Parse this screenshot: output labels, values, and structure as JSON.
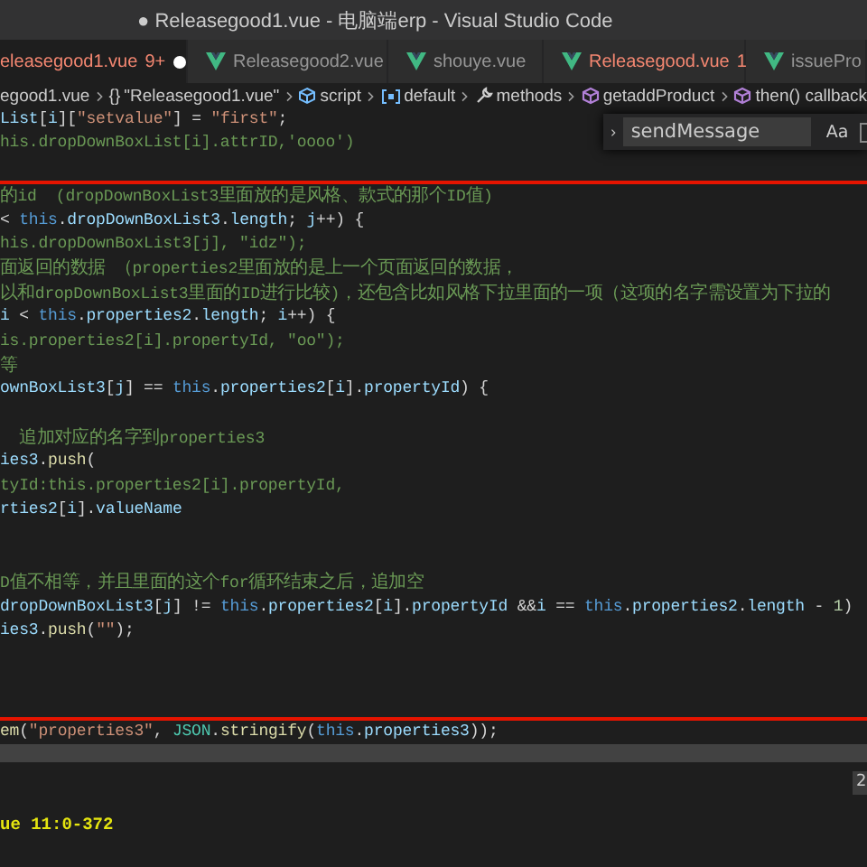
{
  "window": {
    "title": "● Releasegood1.vue - 电脑端erp - Visual Studio Code"
  },
  "tabs": [
    {
      "label": "eleasegood1.vue",
      "problems": "9+",
      "kind": "cut",
      "selected": true,
      "has_errors": true,
      "dirty": true
    },
    {
      "label": "Releasegood2.vue",
      "kind": "file",
      "selected": false,
      "has_errors": false,
      "dirty": false
    },
    {
      "label": "shouye.vue",
      "kind": "file",
      "selected": false,
      "has_errors": false,
      "dirty": false
    },
    {
      "label": "Releasegood.vue",
      "problems": "1",
      "kind": "file",
      "selected": false,
      "has_errors": true,
      "dirty": false
    },
    {
      "label": "issuePro",
      "kind": "file",
      "selected": false,
      "has_errors": false,
      "dirty": false
    }
  ],
  "breadcrumbs": [
    {
      "label": "egood1.vue",
      "kind": "file"
    },
    {
      "label": "\"Releasegood1.vue\"",
      "kind": "object",
      "glyph": "{}"
    },
    {
      "label": "script",
      "kind": "module"
    },
    {
      "label": "default",
      "kind": "variable"
    },
    {
      "label": "methods",
      "kind": "property"
    },
    {
      "label": "getaddProduct",
      "kind": "method"
    },
    {
      "label": "then() callback",
      "kind": "method"
    }
  ],
  "editor": {
    "lines": [
      {
        "kind": "code",
        "tokens": [
          {
            "kind": "variable",
            "t": "List"
          },
          {
            "kind": "plain",
            "t": "["
          },
          {
            "kind": "variable",
            "t": "i"
          },
          {
            "kind": "plain",
            "t": "]["
          },
          {
            "kind": "string",
            "t": "\"setvalue\""
          },
          {
            "kind": "plain",
            "t": "] = "
          },
          {
            "kind": "string",
            "t": "\"first\""
          },
          {
            "kind": "plain",
            "t": ";"
          }
        ]
      },
      {
        "kind": "code",
        "tokens": [
          {
            "kind": "comment",
            "t": "his.dropDownBoxList[i].attrID,'oooo')"
          }
        ]
      },
      {
        "kind": "blank"
      },
      {
        "kind": "marker"
      },
      {
        "kind": "code",
        "tokens": [
          {
            "kind": "comment",
            "t": "的id  (dropDownBoxList3里面放的是风格、款式的那个ID值)"
          }
        ]
      },
      {
        "kind": "code",
        "tokens": [
          {
            "kind": "plain",
            "t": "< "
          },
          {
            "kind": "keyword",
            "t": "this"
          },
          {
            "kind": "plain",
            "t": "."
          },
          {
            "kind": "variable",
            "t": "dropDownBoxList3"
          },
          {
            "kind": "plain",
            "t": "."
          },
          {
            "kind": "variable",
            "t": "length"
          },
          {
            "kind": "plain",
            "t": "; "
          },
          {
            "kind": "variable",
            "t": "j"
          },
          {
            "kind": "plain",
            "t": "++) {"
          }
        ]
      },
      {
        "kind": "code",
        "tokens": [
          {
            "kind": "comment",
            "t": "his.dropDownBoxList3[j], \"idz\");"
          }
        ]
      },
      {
        "kind": "code",
        "tokens": [
          {
            "kind": "comment",
            "t": "面返回的数据 （properties2里面放的是上一个页面返回的数据，"
          }
        ]
      },
      {
        "kind": "code",
        "tokens": [
          {
            "kind": "comment",
            "t": "以和dropDownBoxList3里面的ID进行比较)，还包含比如风格下拉里面的一项（这项的名字需设置为下拉的"
          }
        ]
      },
      {
        "kind": "code",
        "tokens": [
          {
            "kind": "variable",
            "t": "i"
          },
          {
            "kind": "plain",
            "t": " < "
          },
          {
            "kind": "keyword",
            "t": "this"
          },
          {
            "kind": "plain",
            "t": "."
          },
          {
            "kind": "variable",
            "t": "properties2"
          },
          {
            "kind": "plain",
            "t": "."
          },
          {
            "kind": "variable",
            "t": "length"
          },
          {
            "kind": "plain",
            "t": "; "
          },
          {
            "kind": "variable",
            "t": "i"
          },
          {
            "kind": "plain",
            "t": "++) {"
          }
        ]
      },
      {
        "kind": "code",
        "tokens": [
          {
            "kind": "comment",
            "t": "is.properties2[i].propertyId, \"oo\");"
          }
        ]
      },
      {
        "kind": "code",
        "tokens": [
          {
            "kind": "comment",
            "t": "等"
          }
        ]
      },
      {
        "kind": "code",
        "tokens": [
          {
            "kind": "variable",
            "t": "ownBoxList3"
          },
          {
            "kind": "plain",
            "t": "["
          },
          {
            "kind": "variable",
            "t": "j"
          },
          {
            "kind": "plain",
            "t": "] == "
          },
          {
            "kind": "keyword",
            "t": "this"
          },
          {
            "kind": "plain",
            "t": "."
          },
          {
            "kind": "variable",
            "t": "properties2"
          },
          {
            "kind": "plain",
            "t": "["
          },
          {
            "kind": "variable",
            "t": "i"
          },
          {
            "kind": "plain",
            "t": "]."
          },
          {
            "kind": "variable",
            "t": "propertyId"
          },
          {
            "kind": "plain",
            "t": ") {"
          }
        ]
      },
      {
        "kind": "blank"
      },
      {
        "kind": "code",
        "tokens": [
          {
            "kind": "comment",
            "t": "  追加对应的名字到properties3"
          }
        ]
      },
      {
        "kind": "code",
        "tokens": [
          {
            "kind": "variable",
            "t": "ies3"
          },
          {
            "kind": "plain",
            "t": "."
          },
          {
            "kind": "function",
            "t": "push"
          },
          {
            "kind": "plain",
            "t": "("
          }
        ]
      },
      {
        "kind": "code",
        "tokens": [
          {
            "kind": "comment",
            "t": "tyId:this.properties2[i].propertyId,"
          }
        ]
      },
      {
        "kind": "code",
        "tokens": [
          {
            "kind": "variable",
            "t": "rties2"
          },
          {
            "kind": "plain",
            "t": "["
          },
          {
            "kind": "variable",
            "t": "i"
          },
          {
            "kind": "plain",
            "t": "]."
          },
          {
            "kind": "variable",
            "t": "valueName"
          }
        ]
      },
      {
        "kind": "blank"
      },
      {
        "kind": "blank"
      },
      {
        "kind": "code",
        "tokens": [
          {
            "kind": "comment",
            "t": "D值不相等，并且里面的这个for循环结束之后，追加空"
          }
        ]
      },
      {
        "kind": "code",
        "tokens": [
          {
            "kind": "variable",
            "t": "dropDownBoxList3"
          },
          {
            "kind": "plain",
            "t": "["
          },
          {
            "kind": "variable",
            "t": "j"
          },
          {
            "kind": "plain",
            "t": "] != "
          },
          {
            "kind": "keyword",
            "t": "this"
          },
          {
            "kind": "plain",
            "t": "."
          },
          {
            "kind": "variable",
            "t": "properties2"
          },
          {
            "kind": "plain",
            "t": "["
          },
          {
            "kind": "variable",
            "t": "i"
          },
          {
            "kind": "plain",
            "t": "]."
          },
          {
            "kind": "variable",
            "t": "propertyId"
          },
          {
            "kind": "plain",
            "t": " &&"
          },
          {
            "kind": "variable",
            "t": "i"
          },
          {
            "kind": "plain",
            "t": " == "
          },
          {
            "kind": "keyword",
            "t": "this"
          },
          {
            "kind": "plain",
            "t": "."
          },
          {
            "kind": "variable",
            "t": "properties2"
          },
          {
            "kind": "plain",
            "t": "."
          },
          {
            "kind": "variable",
            "t": "length"
          },
          {
            "kind": "plain",
            "t": " - "
          },
          {
            "kind": "number",
            "t": "1"
          },
          {
            "kind": "plain",
            "t": ")"
          }
        ]
      },
      {
        "kind": "code",
        "tokens": [
          {
            "kind": "variable",
            "t": "ies3"
          },
          {
            "kind": "plain",
            "t": "."
          },
          {
            "kind": "function",
            "t": "push"
          },
          {
            "kind": "plain",
            "t": "("
          },
          {
            "kind": "string",
            "t": "\"\""
          },
          {
            "kind": "plain",
            "t": ");"
          }
        ]
      },
      {
        "kind": "blank"
      },
      {
        "kind": "blank"
      },
      {
        "kind": "blank"
      },
      {
        "kind": "marker"
      },
      {
        "kind": "code",
        "tokens": [
          {
            "kind": "function",
            "t": "em"
          },
          {
            "kind": "plain",
            "t": "("
          },
          {
            "kind": "string",
            "t": "\"properties3\""
          },
          {
            "kind": "plain",
            "t": ", "
          },
          {
            "kind": "type",
            "t": "JSON"
          },
          {
            "kind": "plain",
            "t": "."
          },
          {
            "kind": "function",
            "t": "stringify"
          },
          {
            "kind": "plain",
            "t": "("
          },
          {
            "kind": "keyword",
            "t": "this"
          },
          {
            "kind": "plain",
            "t": "."
          },
          {
            "kind": "variable",
            "t": "properties3"
          },
          {
            "kind": "plain",
            "t": "));"
          }
        ]
      }
    ]
  },
  "find": {
    "value": "sendMessage",
    "case_label": "Aa"
  },
  "panel": {
    "badge": "2",
    "lines": [
      "ue 11:0-372"
    ]
  }
}
